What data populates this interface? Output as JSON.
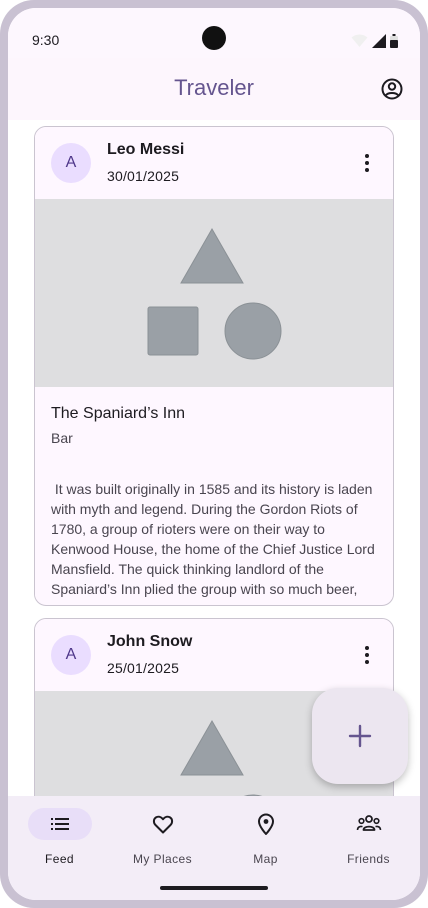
{
  "status_bar": {
    "time": "9:30"
  },
  "app_bar": {
    "title": "Traveler",
    "account_icon": "account-circle-icon"
  },
  "posts": [
    {
      "avatar": "A",
      "name": "Leo Messi",
      "date": "30/01/2025",
      "title": "The Spaniard’s Inn",
      "subtitle": "Bar",
      "text": " It was built originally in 1585 and its history is laden with myth and legend. During the Gordon Riots of 1780, a group of rioters were on their way to Kenwood House, the home of the Chief Justice Lord Mansfield. The quick thinking landlord of the Spaniard’s Inn plied the group with so much beer,"
    },
    {
      "avatar": "A",
      "name": "John Snow",
      "date": "25/01/2025"
    }
  ],
  "fab": {
    "icon": "plus-icon"
  },
  "bottom_nav": {
    "items": [
      {
        "label": "Feed",
        "icon": "feed-list-icon",
        "active": true
      },
      {
        "label": "My Places",
        "icon": "heart-icon",
        "active": false
      },
      {
        "label": "Map",
        "icon": "map-pin-icon",
        "active": false
      },
      {
        "label": "Friends",
        "icon": "people-icon",
        "active": false
      }
    ]
  },
  "colors": {
    "primary": "#65558f",
    "surface": "#fef7ff",
    "nav_background": "#f3edf7",
    "active_indicator": "#e8def8",
    "placeholder_shape": "#9aa0a6"
  }
}
